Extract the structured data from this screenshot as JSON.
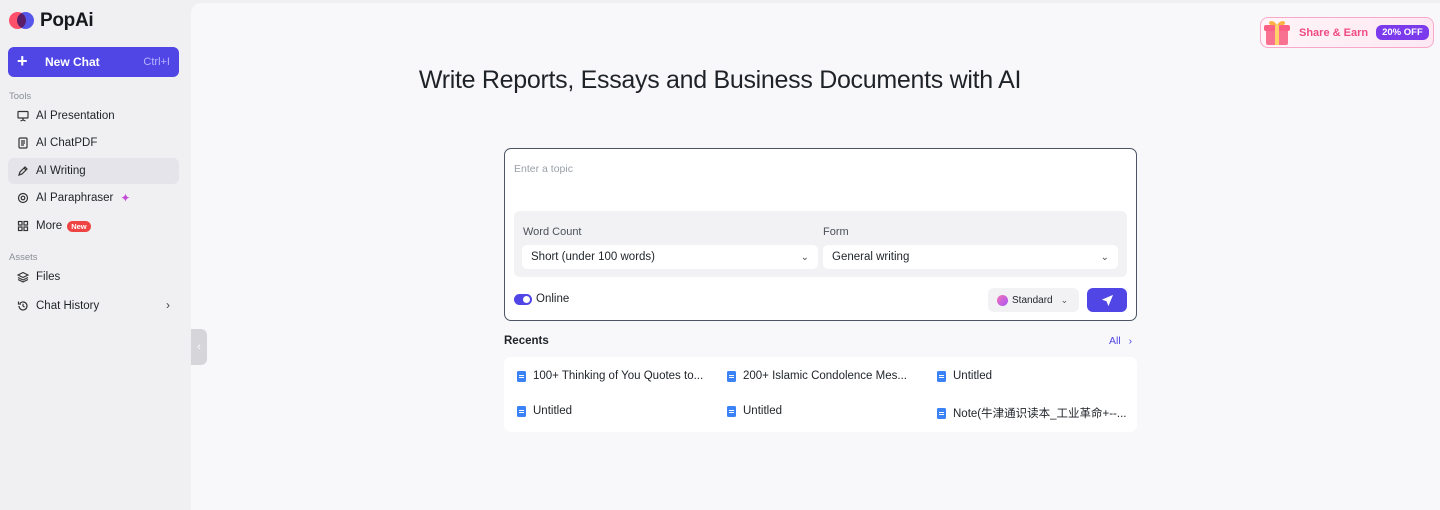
{
  "app": {
    "name": "PopAi"
  },
  "sidebar": {
    "new_chat": {
      "label": "New Chat",
      "shortcut": "Ctrl+I"
    },
    "tools_label": "Tools",
    "tools": [
      {
        "label": "AI Presentation",
        "icon": "presentation-icon"
      },
      {
        "label": "AI ChatPDF",
        "icon": "document-icon"
      },
      {
        "label": "AI Writing",
        "icon": "pen-icon",
        "active": true
      },
      {
        "label": "AI Paraphraser",
        "icon": "target-icon"
      },
      {
        "label": "More",
        "icon": "grid-icon",
        "badge": "New"
      }
    ],
    "assets_label": "Assets",
    "assets": [
      {
        "label": "Files",
        "icon": "layers-icon"
      },
      {
        "label": "Chat History",
        "icon": "history-icon"
      }
    ]
  },
  "promo": {
    "label": "Share & Earn",
    "badge": "20% OFF"
  },
  "main": {
    "headline": "Write Reports, Essays and Business Documents with AI",
    "topic_placeholder": "Enter a topic",
    "word_count": {
      "label": "Word Count",
      "value": "Short (under 100 words)"
    },
    "form": {
      "label": "Form",
      "value": "General writing"
    },
    "online_label": "Online",
    "online_enabled": true,
    "model": "Standard"
  },
  "recents": {
    "title": "Recents",
    "all_label": "All",
    "items": [
      "100+ Thinking of You Quotes to...",
      "200+ Islamic Condolence Mes...",
      "Untitled",
      "Untitled",
      "Untitled",
      "Note(牛津通识读本_工业革命+--..."
    ]
  },
  "colors": {
    "accent": "#4f46e5",
    "promo": "#ef4b82",
    "badge_new": "#ef4444"
  }
}
